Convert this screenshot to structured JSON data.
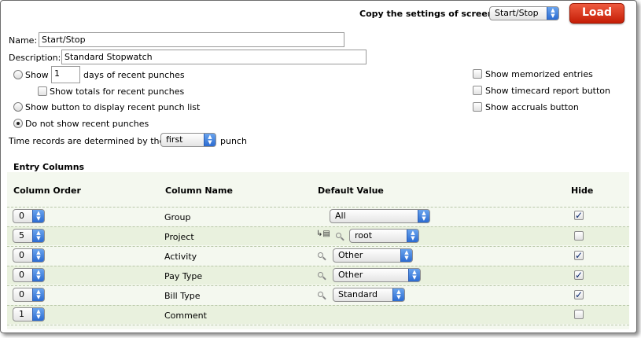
{
  "header": {
    "copy_label": "Copy the settings of screen:",
    "copy_value": "Start/Stop",
    "load_button": "Load"
  },
  "form": {
    "name_label": "Name:",
    "name_value": "Start/Stop",
    "description_label": "Description:",
    "description_value": "Standard Stopwatch",
    "show_label": "Show",
    "show_days_value": "1",
    "days_label": "days of recent punches",
    "show_totals_label": "Show totals for recent punches",
    "show_button_label": "Show button to display recent punch list",
    "do_not_show_label": "Do not show recent punches",
    "time_records_label": "Time records are determined by the",
    "time_records_value": "first",
    "punch_label": "punch"
  },
  "options": {
    "memorized_label": "Show memorized entries",
    "timecard_label": "Show timecard report button",
    "accruals_label": "Show accruals button"
  },
  "entry_columns": {
    "title": "Entry Columns",
    "headers": {
      "order": "Column Order",
      "name": "Column Name",
      "default": "Default Value",
      "hide": "Hide"
    },
    "rows": [
      {
        "order": "0",
        "name": "Group",
        "default": "All",
        "hide": true
      },
      {
        "order": "5",
        "name": "Project",
        "default": "root",
        "hide": false
      },
      {
        "order": "0",
        "name": "Activity",
        "default": "Other",
        "hide": true
      },
      {
        "order": "0",
        "name": "Pay Type",
        "default": "Other",
        "hide": true
      },
      {
        "order": "0",
        "name": "Bill Type",
        "default": "Standard",
        "hide": true
      },
      {
        "order": "1",
        "name": "Comment",
        "default": "",
        "hide": false
      }
    ]
  },
  "state": {
    "recent_mode": "do_not_show",
    "show_totals": false,
    "show_memorized": false,
    "show_timecard": false,
    "show_accruals": false
  },
  "colors": {
    "load_button": "#d8280c",
    "select_arrow": "#2f72d8",
    "table_background": "#f4f8ef"
  }
}
